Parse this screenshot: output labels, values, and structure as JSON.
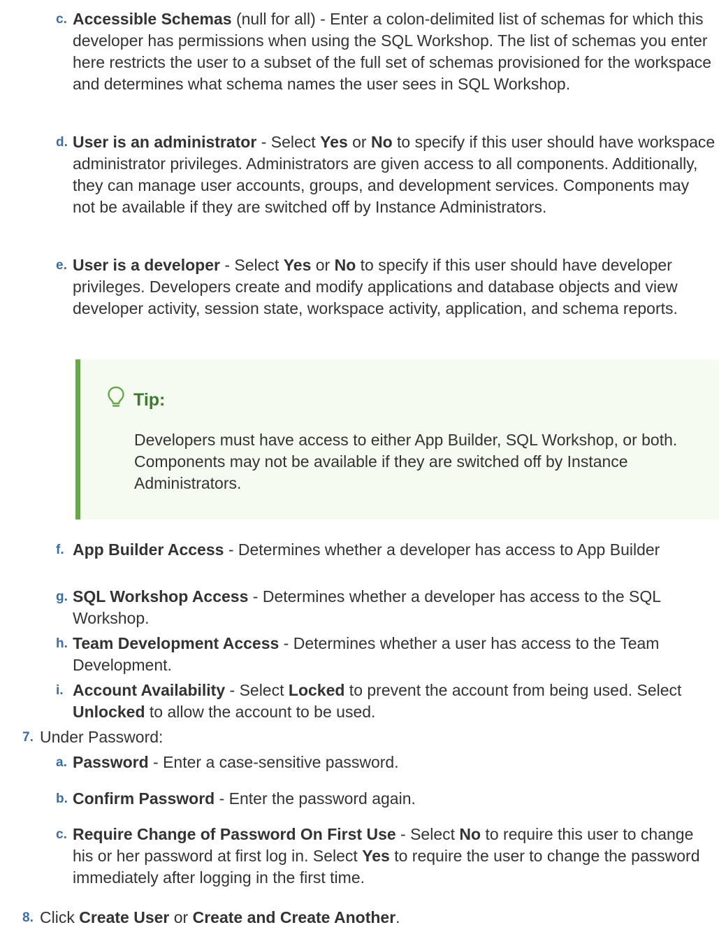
{
  "substeps_top": [
    {
      "label": "c.",
      "title": "Accessible Schemas",
      "rest": " (null for all) - Enter a colon-delimited list of schemas for which this developer has permissions when using the SQL Workshop. The list of schemas you enter here restricts the user to a subset of the full set of schemas provisioned for the workspace and determines what schema names the user sees in SQL Workshop."
    },
    {
      "label": "d.",
      "title": "User is an administrator",
      "mid1": " - Select ",
      "b1": "Yes",
      "mid2": " or ",
      "b2": "No",
      "rest": " to specify if this user should have workspace administrator privileges. Administrators are given access to all components. Additionally, they can manage user accounts, groups, and development services. Components may not be available if they are switched off by Instance Administrators."
    },
    {
      "label": "e.",
      "title": "User is a developer",
      "mid1": " - Select ",
      "b1": "Yes",
      "mid2": " or ",
      "b2": "No",
      "rest": " to specify if this user should have developer privileges. Developers create and modify applications and database objects and view developer activity, session state, workspace activity, application, and schema reports."
    }
  ],
  "tip": {
    "icon": "lightbulb-icon",
    "title": "Tip:",
    "body": "Developers must have access to either App Builder, SQL Workshop, or both. Components may not be available if they are switched off by Instance Administrators."
  },
  "substeps_mid": [
    {
      "label": "f.",
      "title": "App Builder Access",
      "rest": " - Determines whether a developer has access to App Builder"
    },
    {
      "label": "g.",
      "title": "SQL Workshop Access",
      "rest": " - Determines whether a developer has access to the SQL Workshop."
    },
    {
      "label": "h.",
      "title": "Team Development Access",
      "rest": " - Determines whether a user has access to the Team Development."
    },
    {
      "label": "i.",
      "title": "Account Availability",
      "mid1": " - Select ",
      "b1": "Locked",
      "mid2": " to prevent the account from being used. Select ",
      "b2": "Unlocked",
      "rest": " to allow the account to be used."
    }
  ],
  "step7": {
    "num": "7.",
    "text": "Under Password:",
    "substeps": [
      {
        "label": "a.",
        "title": "Password",
        "rest": " - Enter a case-sensitive password."
      },
      {
        "label": "b.",
        "title": "Confirm Password",
        "rest": " - Enter the password again."
      },
      {
        "label": "c.",
        "title": "Require Change of Password On First Use",
        "mid1": " - Select ",
        "b1": "No",
        "mid2": " to require this user to change his or her password at first log in. Select ",
        "b2": "Yes",
        "rest": " to require the user to change the password immediately after logging in the first time."
      }
    ]
  },
  "step8": {
    "num": "8.",
    "pre": "Click ",
    "b1": "Create User",
    "mid": " or ",
    "b2": "Create and Create Another",
    "post": "."
  },
  "colors": {
    "label": "#3a6ea5",
    "tip_border": "#67a84a",
    "tip_bg": "#f5fbf1",
    "tip_title": "#3c7a2e"
  }
}
